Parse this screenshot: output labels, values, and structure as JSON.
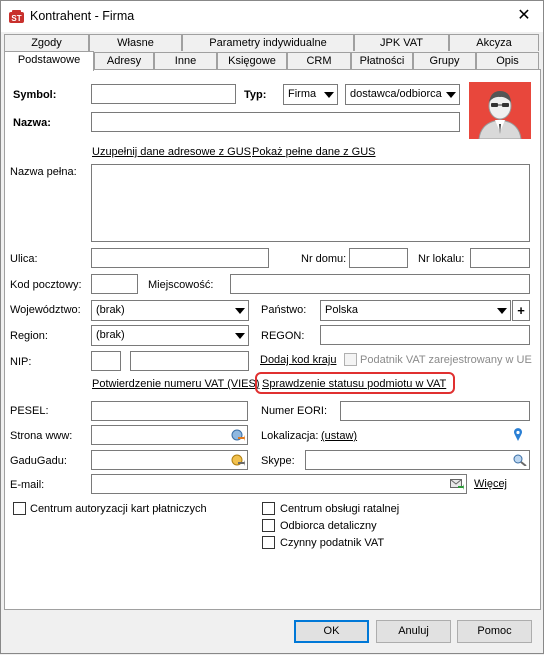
{
  "window": {
    "title": "Kontrahent - Firma",
    "close_symbol": "✕"
  },
  "tabs_row1": [
    "Zgody",
    "Własne",
    "Parametry indywidualne",
    "JPK VAT",
    "Akcyza"
  ],
  "tabs_row2": [
    "Podstawowe",
    "Adresy",
    "Inne",
    "Księgowe",
    "CRM",
    "Płatności",
    "Grupy",
    "Opis"
  ],
  "active_tab": "Podstawowe",
  "form": {
    "symbol_label": "Symbol:",
    "typ_label": "Typ:",
    "typ_value": "Firma",
    "rodzaj_value": "dostawca/odbiorca",
    "nazwa_label": "Nazwa:",
    "gus_link": "Uzupełnij dane adresowe z GUS",
    "gus_full_link": "Pokaż pełne dane z GUS",
    "nazwa_pelna_label": "Nazwa pełna:",
    "ulica_label": "Ulica:",
    "nr_domu_label": "Nr domu:",
    "nr_lokalu_label": "Nr lokalu:",
    "kod_label": "Kod pocztowy:",
    "miejscowosc_label": "Miejscowość:",
    "wojewodztwo_label": "Województwo:",
    "wojewodztwo_value": "(brak)",
    "panstwo_label": "Państwo:",
    "panstwo_value": "Polska",
    "add_symbol": "+",
    "region_label": "Region:",
    "region_value": "(brak)",
    "regon_label": "REGON:",
    "nip_label": "NIP:",
    "dodaj_kod_link": "Dodaj kod kraju",
    "vat_ue_label": "Podatnik VAT zarejestrowany w UE",
    "vies_link": "Potwierdzenie numeru VAT (VIES)",
    "status_link": "Sprawdzenie statusu podmiotu w VAT",
    "pesel_label": "PESEL:",
    "eori_label": "Numer EORI:",
    "www_label": "Strona www:",
    "lokalizacja_label": "Lokalizacja:",
    "lokalizacja_link": "(ustaw)",
    "gadugadu_label": "GaduGadu:",
    "skype_label": "Skype:",
    "email_label": "E-mail:",
    "wiecej_link": "Więcej",
    "chk_cakp": "Centrum autoryzacji kart płatniczych",
    "chk_cor": "Centrum obsługi ratalnej",
    "chk_odbiorca": "Odbiorca detaliczny",
    "chk_czynny": "Czynny podatnik VAT"
  },
  "buttons": {
    "ok": "OK",
    "cancel": "Anuluj",
    "help": "Pomoc"
  },
  "colors": {
    "highlight": "#e03030",
    "avatar_bg": "#e8473c",
    "link": "#000000"
  },
  "icons": [
    "app-icon",
    "close-icon",
    "user-avatar-icon",
    "globe-arrow-icon",
    "pin-icon",
    "search-icon",
    "mail-icon",
    "chevron-down-icon"
  ]
}
